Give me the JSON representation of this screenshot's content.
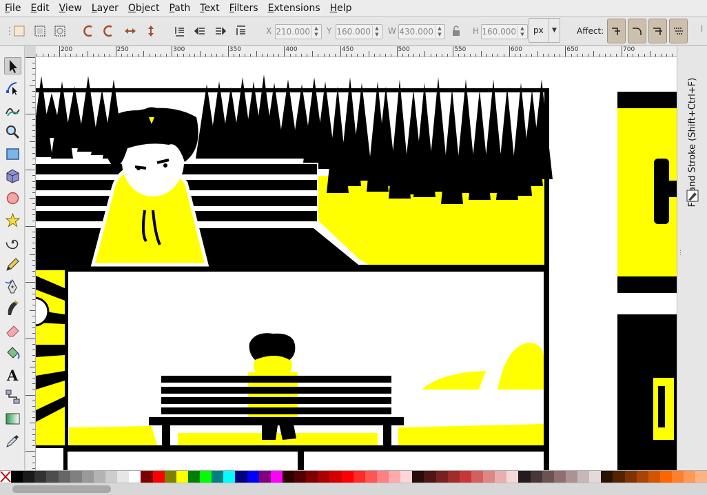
{
  "menu": [
    "File",
    "Edit",
    "View",
    "Layer",
    "Object",
    "Path",
    "Text",
    "Filters",
    "Extensions",
    "Help"
  ],
  "controls": {
    "x_label": "X",
    "x_value": "210.000",
    "y_label": "Y",
    "y_value": "160.000",
    "w_label": "W",
    "w_value": "430.000",
    "h_label": "H",
    "h_value": "160.000",
    "unit": "px",
    "affect_label": "Affect:"
  },
  "tools": [
    "selector-tool",
    "node-tool",
    "tweak-tool",
    "zoom-tool",
    "rect-tool",
    "3dbox-tool",
    "ellipse-tool",
    "star-tool",
    "spiral-tool",
    "pencil-tool",
    "pen-tool",
    "calligraphy-tool",
    "eraser-tool",
    "paint-bucket-tool",
    "text-tool",
    "connector-tool",
    "gradient-tool",
    "dropper-tool"
  ],
  "ruler": {
    "labels": [
      "200",
      "250",
      "300",
      "350",
      "400",
      "450",
      "500",
      "550",
      "600",
      "650",
      "700"
    ]
  },
  "dock": {
    "panel_title": "Fill and Stroke (Shift+Ctrl+F)"
  },
  "palette": [
    "#000000",
    "#1a1a1a",
    "#333333",
    "#4d4d4d",
    "#666666",
    "#808080",
    "#999999",
    "#b3b3b3",
    "#cccccc",
    "#e6e6e6",
    "#ffffff",
    "#800000",
    "#ff0000",
    "#808000",
    "#ffff00",
    "#008000",
    "#00ff00",
    "#008080",
    "#00ffff",
    "#000080",
    "#0000ff",
    "#800080",
    "#ff00ff",
    "#2b0000",
    "#550000",
    "#800000",
    "#aa0000",
    "#d40000",
    "#ff0000",
    "#ff2a2a",
    "#ff5555",
    "#ff8080",
    "#ffaaaa",
    "#ffd5d5",
    "#280b0b",
    "#501616",
    "#782121",
    "#a02c2c",
    "#c83737",
    "#d35f5f",
    "#de8787",
    "#e9afaf",
    "#f4d7d7",
    "#241c1c",
    "#483737",
    "#6c5353",
    "#916f6f",
    "#ac9393",
    "#c8b7b7",
    "#e3dbdb",
    "#2b1100",
    "#552200",
    "#803300",
    "#aa4400",
    "#d45500",
    "#ff6600",
    "#ff7f2a",
    "#ff9955",
    "#ffb380"
  ]
}
